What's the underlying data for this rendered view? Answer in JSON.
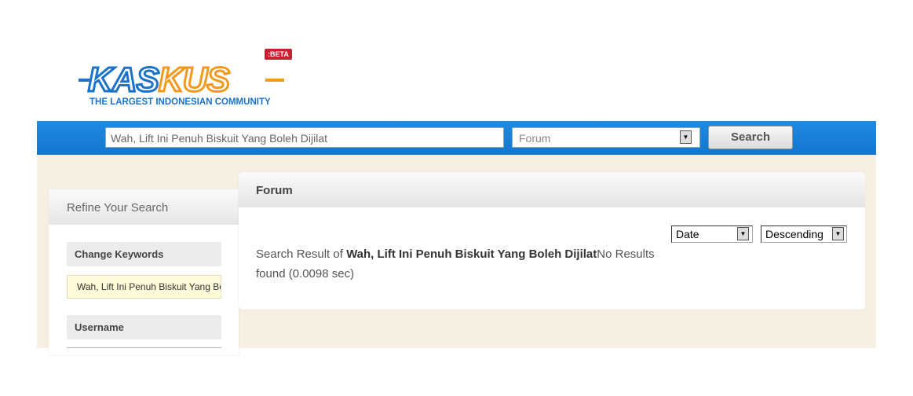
{
  "logo": {
    "text_blue": "KAS",
    "text_orange": "KUS",
    "badge": ":BETA",
    "tagline": "THE LARGEST INDONESIAN COMMUNITY"
  },
  "search_bar": {
    "query": "Wah, Lift Ini Penuh Biskuit Yang Boleh Dijilat",
    "scope": "Forum",
    "button": "Search"
  },
  "refine": {
    "title": "Refine Your Search",
    "change_keywords_label": "Change Keywords",
    "keywords_value": "Wah, Lift Ini Penuh Biskuit Yang Boleh Dijilat",
    "username_label": "Username"
  },
  "results": {
    "title": "Forum",
    "sort_by": "Date",
    "sort_order": "Descending",
    "prefix": "Search Result of ",
    "query": "Wah, Lift Ini Penuh Biskuit Yang Boleh Dijilat",
    "suffix": "No Results found (0.0098 sec)"
  },
  "colors": {
    "bar": "#1476cf",
    "background": "#f8efe3",
    "brand_blue": "#1a73c9",
    "brand_orange": "#f39a1e",
    "beta": "#c8202f"
  }
}
